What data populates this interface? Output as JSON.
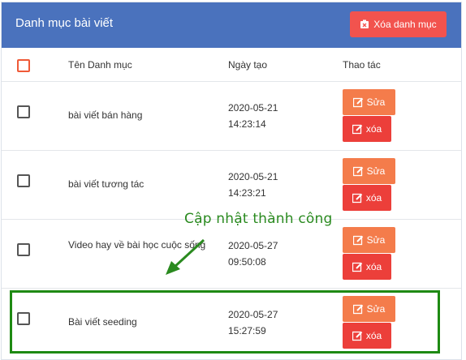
{
  "header": {
    "title": "Danh mục bài viết",
    "delete_category_label": "Xóa danh mục"
  },
  "table": {
    "columns": [
      "Tên Danh mục",
      "Ngày tạo",
      "Thao tác"
    ],
    "rows": [
      {
        "name": "bài viết bán hàng",
        "date": "2020-05-21",
        "time": "14:23:14"
      },
      {
        "name": "bài viết tương tác",
        "date": "2020-05-21",
        "time": "14:23:21"
      },
      {
        "name": "Video hay về bài học cuộc sống",
        "date": "2020-05-27",
        "time": "09:50:08"
      },
      {
        "name": "Bài viết seeding",
        "date": "2020-05-27",
        "time": "15:27:59"
      }
    ],
    "edit_label": "Sửa",
    "delete_label": "xóa"
  },
  "annotation": {
    "text": "Cập nhật thành công"
  },
  "colors": {
    "header_bg": "#4a72bd",
    "delete_category_bg": "#f2534e",
    "edit_bg": "#f47c4b",
    "delete_bg": "#ec3f3a",
    "highlight": "#1e8a13",
    "annotation": "#2a8a1f"
  }
}
